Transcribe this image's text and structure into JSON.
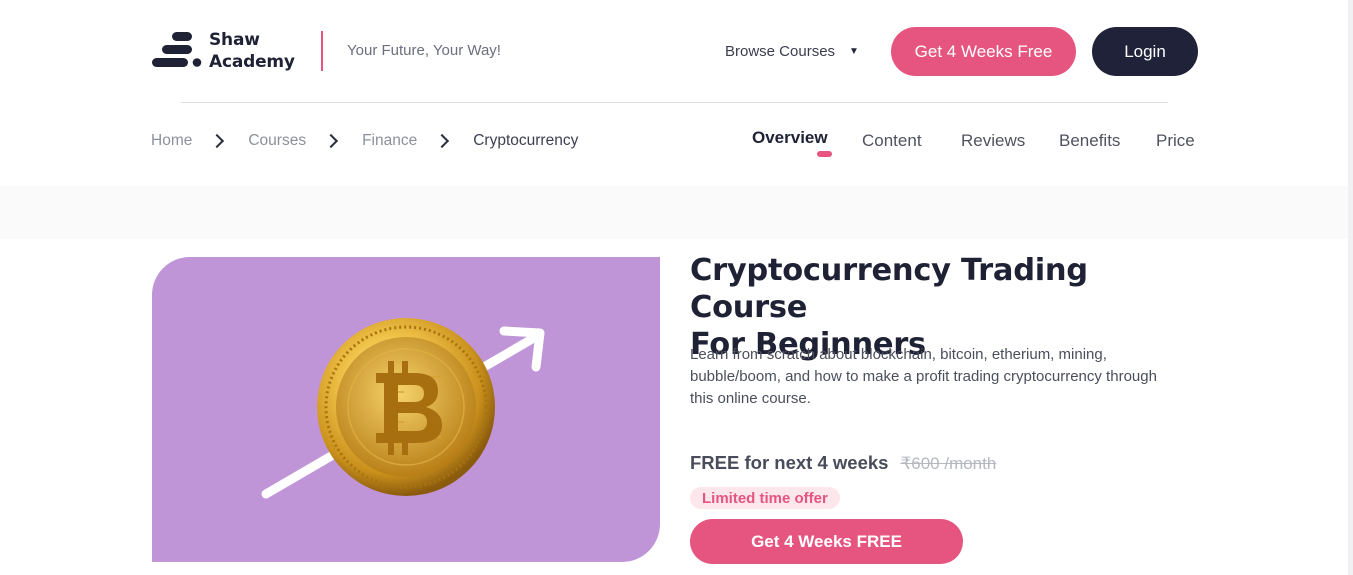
{
  "header": {
    "logo_line1": "Shaw",
    "logo_line2": "Academy",
    "tagline": "Your Future, Your Way!",
    "browse_label": "Browse Courses",
    "cta_label": "Get 4 Weeks Free",
    "login_label": "Login"
  },
  "breadcrumb": [
    "Home",
    "Courses",
    "Finance",
    "Cryptocurrency"
  ],
  "tabs": [
    {
      "label": "Overview",
      "active": true
    },
    {
      "label": "Content",
      "active": false
    },
    {
      "label": "Reviews",
      "active": false
    },
    {
      "label": "Benefits",
      "active": false
    },
    {
      "label": "Price",
      "active": false
    }
  ],
  "course": {
    "title_line1": "Cryptocurrency Trading Course",
    "title_line2": "For Beginners",
    "description": "Learn from scratch about blockchain, bitcoin, etherium, mining, bubble/boom, and how to make a profit trading cryptocurrency through this online course.",
    "free_text": "FREE for next 4 weeks",
    "old_price": "₹600 /month",
    "badge": "Limited time offer",
    "cta_label": "Get 4 Weeks FREE",
    "hero_icons": [
      "bitcoin-coin-icon",
      "up-arrow-icon"
    ]
  },
  "colors": {
    "accent": "#e5557f",
    "dark": "#1f2238",
    "hero_bg": "#bf95d8",
    "badge_bg": "#fde6ec"
  }
}
